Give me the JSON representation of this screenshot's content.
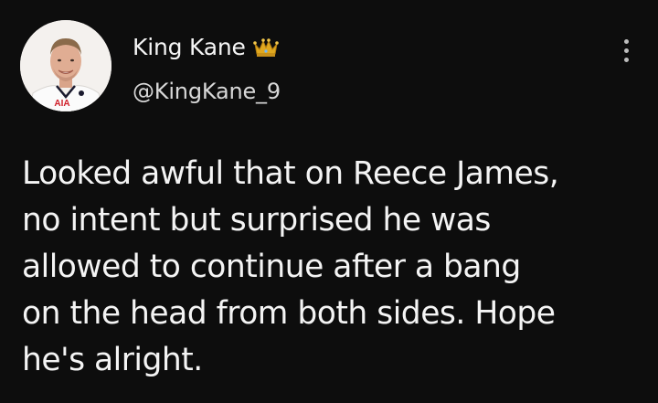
{
  "user": {
    "display_name": "King Kane",
    "verified_badge": "crown-icon",
    "handle": "@KingKane_9",
    "avatar": {
      "shirt_text": "AIA",
      "icon": "avatar-photo"
    }
  },
  "menu": {
    "icon": "more-options-icon"
  },
  "tweet": {
    "text": "Looked awful that on Reece James,\nno intent but surprised he was\nallowed to continue after a bang\non the head from both sides. Hope\nhe's alright."
  },
  "colors": {
    "background": "#0d0d0d",
    "text": "#f4f4f4",
    "handle": "#d8d8d8",
    "crown_gold": "#e0a81f"
  }
}
